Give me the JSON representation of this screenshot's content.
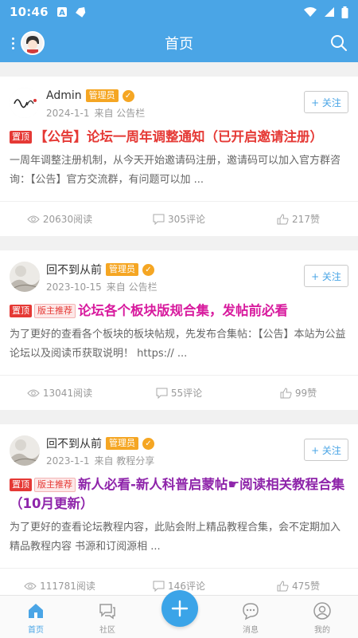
{
  "status_bar": {
    "time": "10:46"
  },
  "app_bar": {
    "title": "首页"
  },
  "posts": [
    {
      "author": "Admin",
      "role": "管理员",
      "date": "2024-1-1",
      "source": "来自 公告栏",
      "follow": "+ 关注",
      "tags": [
        "置顶"
      ],
      "title": "【公告】论坛一周年调整通知（已开启邀请注册）",
      "excerpt": "一周年调整注册机制，从今天开始邀请码注册，邀请码可以加入官方群咨询：【公告】官方交流群，有问题可以加 ...",
      "reads": "20630阅读",
      "comments": "305评论",
      "likes": "217赞"
    },
    {
      "author": "回不到从前",
      "role": "管理员",
      "date": "2023-10-15",
      "source": "来自 公告栏",
      "follow": "+ 关注",
      "tags": [
        "置顶",
        "版主推荐"
      ],
      "title": "论坛各个板块版规合集，发帖前必看",
      "excerpt": "为了更好的查看各个板块的板块帖规，先发布合集帖：【公告】本站为公益论坛以及阅读币获取说明！ https:// ...",
      "reads": "13041阅读",
      "comments": "55评论",
      "likes": "99赞"
    },
    {
      "author": "回不到从前",
      "role": "管理员",
      "date": "2023-1-1",
      "source": "来自 教程分享",
      "follow": "+ 关注",
      "tags": [
        "置顶",
        "版主推荐"
      ],
      "title": "新人必看-新人科普启蒙帖☛阅读相关教程合集（10月更新）",
      "excerpt": "为了更好的查看论坛教程内容，此贴会附上精品教程合集，会不定期加入精品教程内容 书源和订阅源相 ...",
      "reads": "111781阅读",
      "comments": "146评论",
      "likes": "475赞"
    }
  ],
  "bottom_nav": [
    "首页",
    "社区",
    "消息",
    "我的"
  ],
  "colors": {
    "primary": "#4aa5e6",
    "role_badge": "#f5a623",
    "top_tag": "#e53935"
  }
}
